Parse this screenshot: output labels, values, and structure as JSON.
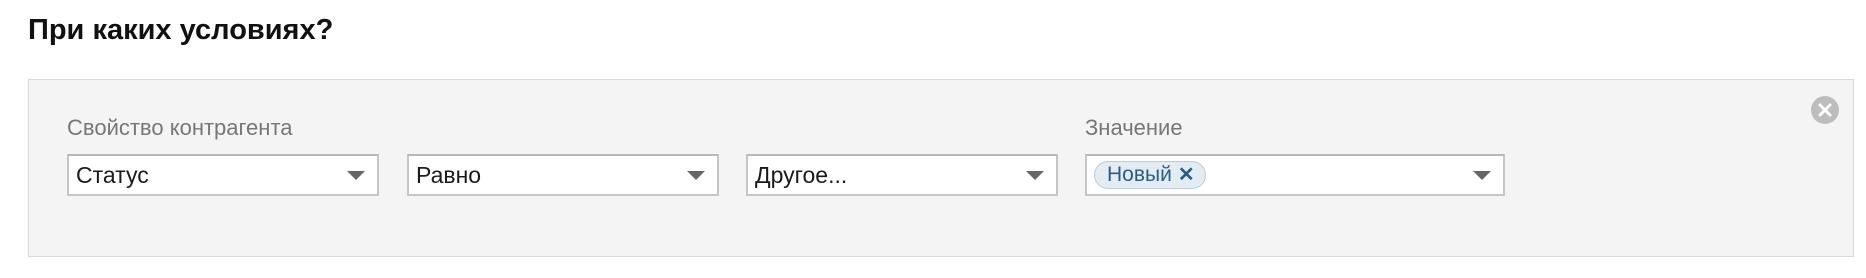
{
  "page": {
    "title": "При каких условиях?"
  },
  "condition": {
    "property_label": "Свойство контрагента",
    "value_label": "Значение",
    "property_select": {
      "value": "Статус"
    },
    "operator_select": {
      "value": "Равно"
    },
    "extra_select": {
      "value": "Другое..."
    },
    "value_select": {
      "tags": [
        {
          "label": "Новый",
          "remove_glyph": "✕"
        }
      ]
    },
    "remove_icon": "close-circle-icon"
  },
  "colors": {
    "panel_background": "#f4f4f4",
    "tag_background": "#e3ecf3",
    "tag_text": "#2a5d86",
    "label_text": "#777777"
  }
}
